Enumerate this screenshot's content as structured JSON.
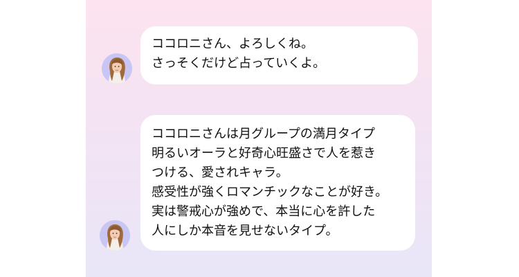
{
  "chat": {
    "messages": [
      {
        "avatar_icon": "fortune-teller-avatar-icon",
        "lines": [
          "ココロニさん、よろしくね。",
          "さっそくだけど占っていくよ。"
        ]
      },
      {
        "avatar_icon": "fortune-teller-avatar-icon",
        "lines": [
          "ココロニさんは月グループの満月タイプ",
          "明るいオーラと好奇心旺盛さで人を惹き",
          "つける、愛されキャラ。",
          "感受性が強くロマンチックなことが好き。",
          "実は警戒心が強めで、本当に心を許した",
          "人にしか本音を見せないタイプ。"
        ]
      }
    ]
  },
  "colors": {
    "panel_top": "#fde3ef",
    "panel_bottom": "#e9e6f8",
    "bubble": "#ffffff",
    "text": "#111111"
  }
}
